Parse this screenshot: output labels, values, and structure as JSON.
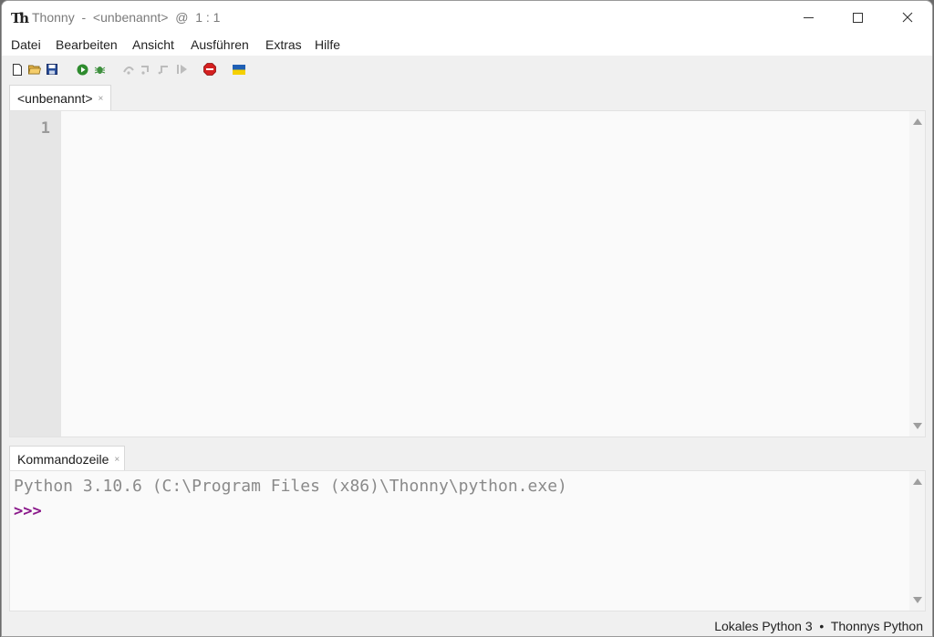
{
  "window": {
    "title": "Thonny  -  <unbenannt>  @  1 : 1",
    "logo": "Th"
  },
  "menu": [
    "Datei",
    "Bearbeiten",
    "Ansicht",
    "Ausführen",
    "Extras",
    "Hilfe"
  ],
  "toolbar": {
    "icons": [
      "new-file-icon",
      "open-file-icon",
      "save-icon",
      "run-icon",
      "debug-icon",
      "step-over-icon",
      "step-into-icon",
      "step-out-icon",
      "resume-icon",
      "stop-icon",
      "ukraine-flag-icon"
    ],
    "colors": {
      "run": "#2e8b2e",
      "stop": "#d42020",
      "flag_blue": "#1f5fb4",
      "flag_yellow": "#f5d000"
    }
  },
  "editor": {
    "tab_label": "<unbenannt>",
    "tab_close": "×",
    "line_number": "1"
  },
  "shell": {
    "tab_label": "Kommandozeile",
    "tab_close": "×",
    "banner": "Python 3.10.6 (C:\\Program Files (x86)\\Thonny\\python.exe)",
    "prompt": ">>>",
    "prompt_color": "#8b1a8b"
  },
  "statusbar": {
    "text": "Lokales Python 3  •  Thonnys Python"
  }
}
